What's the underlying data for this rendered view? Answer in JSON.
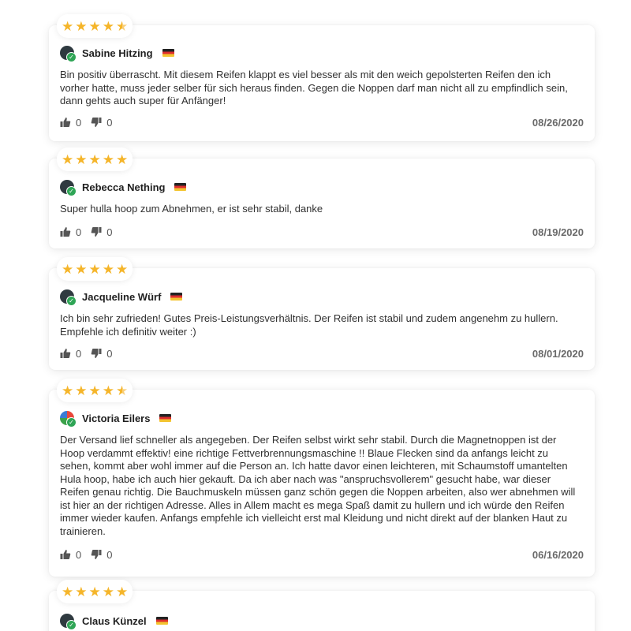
{
  "reviews": [
    {
      "author": "Sabine Hitzing",
      "rating": 4.5,
      "text": "Bin positiv überrascht. Mit diesem Reifen klappt es viel besser als mit den weich gepolsterten Reifen den ich vorher hatte, muss jeder selber für sich heraus finden. Gegen die Noppen darf man nicht all zu empfindlich sein, dann gehts auch super für Anfänger!",
      "likes": "0",
      "dislikes": "0",
      "date": "08/26/2020"
    },
    {
      "author": "Rebecca Nething",
      "rating": 5,
      "text": "Super hulla hoop zum Abnehmen, er ist sehr stabil, danke",
      "likes": "0",
      "dislikes": "0",
      "date": "08/19/2020"
    },
    {
      "author": "Jacqueline Würf",
      "rating": 5,
      "text": "Ich bin sehr zufrieden! Gutes Preis-Leistungsverhältnis. Der Reifen ist stabil und zudem angenehm zu hullern. Empfehle ich definitiv weiter :)",
      "likes": "0",
      "dislikes": "0",
      "date": "08/01/2020"
    },
    {
      "author": "Victoria Eilers",
      "rating": 4.5,
      "text": "Der Versand lief schneller als angegeben. Der Reifen selbst wirkt sehr stabil. Durch die Magnetnoppen ist der Hoop verdammt effektiv! eine richtige Fettverbrennungsmaschine !! Blaue Flecken sind da anfangs leicht zu sehen, kommt aber wohl immer auf die Person an. Ich hatte davor einen leichteren, mit Schaumstoff umantelten Hula hoop, habe ich auch hier gekauft. Da ich aber nach was \"anspruchsvollerem\" gesucht habe, war dieser Reifen genau richtig. Die Bauchmuskeln müssen ganz schön gegen die Noppen arbeiten, also wer abnehmen will ist hier an der richtigen Adresse. Alles in Allem macht es mega Spaß damit zu hullern und ich würde den Reifen immer wieder kaufen. Anfangs empfehle ich vielleicht erst mal Kleidung und nicht direkt auf der blanken Haut zu trainieren.",
      "likes": "0",
      "dislikes": "0",
      "date": "06/16/2020"
    },
    {
      "author": "Claus Künzel",
      "rating": 5
    }
  ],
  "icons": {
    "verified": "verified-check-icon",
    "like": "thumbs-up-icon",
    "dislike": "thumbs-down-icon",
    "flag": "german-flag-icon",
    "star": "star-icon"
  },
  "colors": {
    "star": "#f5b52a",
    "verified": "#2fa556",
    "date": "#6a6a6a"
  }
}
